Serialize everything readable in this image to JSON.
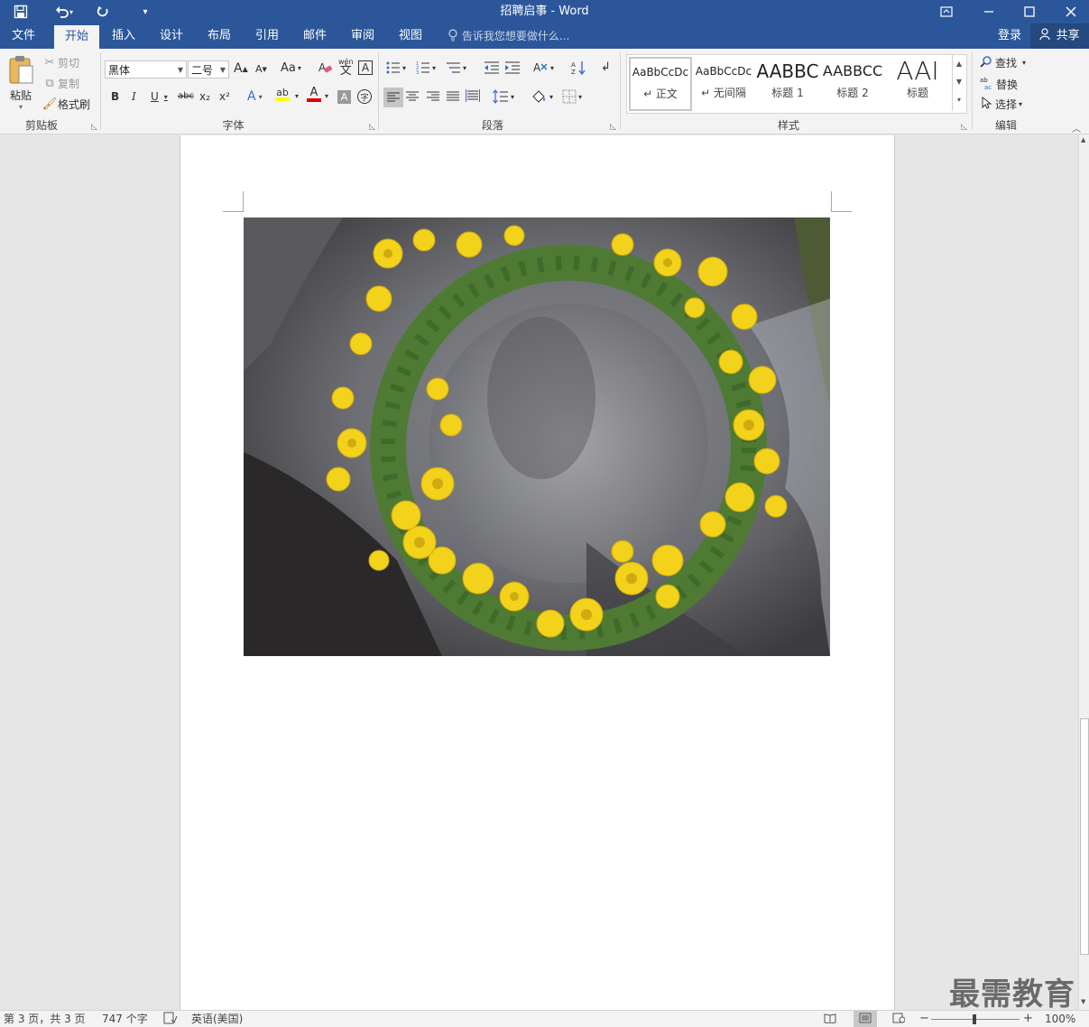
{
  "window": {
    "title": "招聘启事 - Word",
    "quick_access": {
      "save_icon": "save-icon",
      "undo_icon": "undo-icon",
      "redo_icon": "redo-icon",
      "customize_icon": "customize-icon"
    },
    "buttons": {
      "ribbon_display": "ribbon-display-icon",
      "minimize": "minimize-icon",
      "maximize": "maximize-icon",
      "close": "close-icon"
    }
  },
  "tabs": [
    {
      "label": "文件"
    },
    {
      "label": "开始",
      "active": true
    },
    {
      "label": "插入"
    },
    {
      "label": "设计"
    },
    {
      "label": "布局"
    },
    {
      "label": "引用"
    },
    {
      "label": "邮件"
    },
    {
      "label": "审阅"
    },
    {
      "label": "视图"
    }
  ],
  "tell_me": {
    "placeholder": "告诉我您想要做什么..."
  },
  "account": {
    "signin": "登录",
    "share": "共享"
  },
  "ribbon": {
    "clipboard": {
      "group_label": "剪贴板",
      "paste": "粘贴",
      "cut": "剪切",
      "copy": "复制",
      "format_painter": "格式刷"
    },
    "font": {
      "group_label": "字体",
      "font_name": "黑体",
      "font_size": "二号",
      "change_case": "Aa",
      "bold": "B",
      "italic": "I",
      "underline": "U",
      "strikethrough": "abc",
      "subscript": "x₂",
      "superscript": "x²",
      "phonetic_top": "wén",
      "phonetic_bottom": "文",
      "char_border": "A",
      "grow_font": "A",
      "shrink_font": "A",
      "text_effects": "A",
      "highlight": "ab",
      "font_color": "A",
      "char_shading": "A",
      "enclose": "字"
    },
    "paragraph": {
      "group_label": "段落"
    },
    "styles": {
      "group_label": "样式",
      "items": [
        {
          "preview": "AaBbCcDc",
          "label": "↵ 正文"
        },
        {
          "preview": "AaBbCcDc",
          "label": "↵ 无间隔"
        },
        {
          "preview": "AABBC",
          "label": "标题 1"
        },
        {
          "preview": "AABBCC",
          "label": "标题 2"
        },
        {
          "preview": "AAI",
          "label": "标题"
        }
      ]
    },
    "editing": {
      "group_label": "编辑",
      "find": "查找",
      "replace": "替换",
      "select": "选择"
    }
  },
  "document": {
    "image_description_icon": "flower-wreath-photo"
  },
  "status": {
    "page": "第 3 页，共 3 页",
    "words": "747 个字",
    "language": "英语(美国)",
    "zoom": "100%"
  },
  "watermark": "最需教育"
}
